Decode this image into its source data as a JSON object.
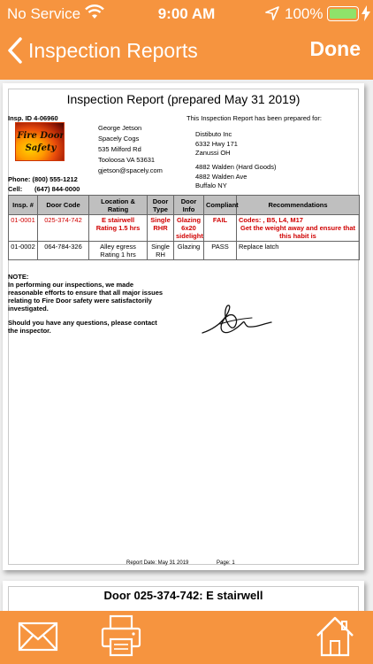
{
  "status_bar": {
    "carrier": "No Service",
    "time": "9:00 AM",
    "battery": "100%"
  },
  "nav": {
    "back_label": "Inspection Reports",
    "done_label": "Done"
  },
  "report": {
    "title": "Inspection Report (prepared May 31 2019)",
    "insp_id": "Insp. ID 4-06960",
    "logo_line1": "Fire Door",
    "logo_line2": "Safety",
    "inspector": {
      "name": "George Jetson",
      "company": "Spacely Cogs",
      "street": "535 Milford Rd",
      "city": "Tooloosa VA 53631",
      "email": "gjetson@spacely.com",
      "phone": "Phone: (800) 555-1212",
      "cell_label": "Cell:",
      "cell": "(647) 844-0000"
    },
    "prepared_for": {
      "heading": "This Inspection Report has been prepared for:",
      "client": "Distibuto Inc",
      "street": "6332 Hwy 171",
      "city": "Zanussi OH",
      "site_name": "4882 Walden (Hard Goods)",
      "site_street": "4882 Walden Ave",
      "site_city": "Buffalo NY"
    },
    "table": {
      "headers": [
        "Insp. #",
        "Door Code",
        "Location & Rating",
        "Door Type",
        "Door Info",
        "Compliant",
        "Recommendations"
      ],
      "rows": [
        {
          "insp": "01-0001",
          "door_code": "025-374-742",
          "location": "E stairwell",
          "rating": "Rating 1.5 hrs",
          "door_type": "Single RHR",
          "door_info": "Glazing 6x20 sidelight",
          "compliant": "FAIL",
          "rec_codes": "Codes: , B5, L4, M17",
          "rec_text": "Get the weight away and ensure that this habit is"
        },
        {
          "insp": "01-0002",
          "door_code": "064-784-326",
          "location": "Alley egress",
          "rating": "Rating 1 hrs",
          "door_type": "Single RH",
          "door_info": "Glazing",
          "compliant": "PASS",
          "rec_codes": "Replace latch",
          "rec_text": ""
        }
      ]
    },
    "note": {
      "heading": "NOTE:",
      "line1": "In performing our inspections, we made",
      "line2": "reasonable efforts to ensure that all major issues",
      "line3": "relating to Fire Door safety were satisfactorily",
      "line4": "investigated.",
      "line5": "Should you have any questions, please contact",
      "line6": "the inspector."
    },
    "footer": {
      "date": "Report Date: May 31 2019",
      "page": "Page: 1"
    }
  },
  "page2": {
    "title": "Door 025-374-742:   E stairwell"
  },
  "colors": {
    "accent": "#f6943f",
    "fail": "#d00000",
    "battery": "#8fe36a"
  },
  "toolbar": {
    "icons": [
      "mail-icon",
      "printer-icon",
      "home-icon"
    ]
  }
}
